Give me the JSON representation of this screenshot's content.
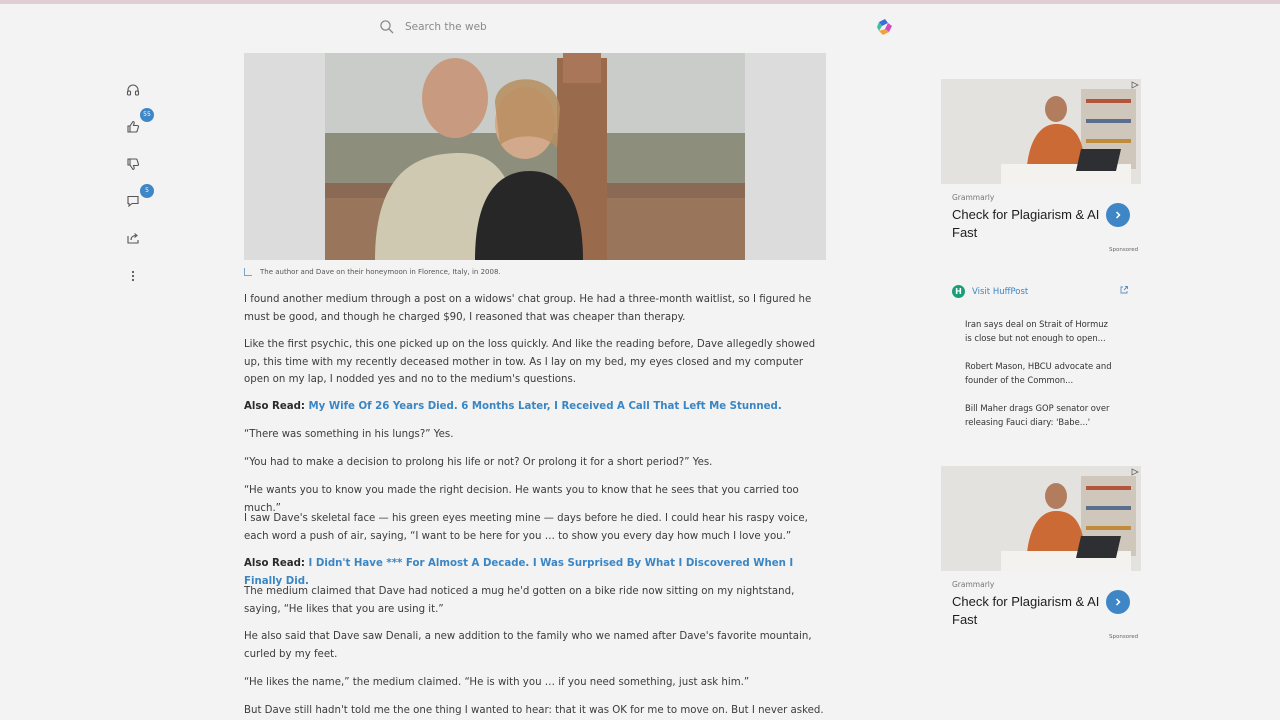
{
  "search": {
    "placeholder": "Search the web"
  },
  "rail": {
    "likes_count": "55",
    "comments_count": "5"
  },
  "hero": {
    "caption": "The author and Dave on their honeymoon in Florence, Italy, in 2008."
  },
  "article": {
    "p1": "I found another medium through a post on a widows' chat group. He had a three-month waitlist, so I figured he must be good, and though he charged $90, I reasoned that was cheaper than therapy.",
    "p2": "Like the first psychic, this one picked up on the loss quickly. And like the reading before, Dave allegedly showed up, this time with my recently deceased mother in tow. As I lay on my bed, my eyes closed and my computer open on my lap, I nodded yes and no to the medium's questions.",
    "also_read_label": "Also Read:",
    "also_read_1": "My Wife Of 26 Years Died. 6 Months Later, I Received A Call That Left Me Stunned.",
    "p3": "“There was something in his lungs?” Yes.",
    "p4": "“You had to make a decision to prolong his life or not? Or prolong it for a short period?” Yes.",
    "p5": "“He wants you to know you made the right decision. He wants you to know that he sees that you carried too much.”",
    "p6": "I saw Dave's skeletal face — his green eyes meeting mine — days before he died. I could hear his raspy voice, each word a push of air, saying, “I want to be here for you … to show you every day how much I love you.”",
    "also_read_2": "I Didn't Have *** For Almost A Decade. I Was Surprised By What I Discovered When I Finally Did.",
    "p7": "The medium claimed that Dave had noticed a mug he'd gotten on a bike ride now sitting on my nightstand, saying, “He likes that you are using it.”",
    "p8": "He also said that Dave saw Denali, a new addition to the family who we named after Dave's favorite mountain, curled by my feet.",
    "p9": "“He likes the name,” the medium claimed. “He is with you … if you need something, just ask him.”",
    "p10": "But Dave still hadn't told me the one thing I wanted to hear: that it was OK for me to move on. But I never asked."
  },
  "ads": [
    {
      "brand": "Grammarly",
      "title": "Check for Plagiarism & AI Fast",
      "sponsored": "Sponsored"
    },
    {
      "brand": "Grammarly",
      "title": "Check for Plagiarism & AI Fast",
      "sponsored": "Sponsored"
    }
  ],
  "huffpost": {
    "link": "Visit HuffPost",
    "items": [
      "Iran says deal on Strait of Hormuz is close but not enough to open...",
      "Robert Mason, HBCU advocate and founder of the Common...",
      "Bill Maher drags GOP senator over releasing Fauci diary: 'Babe...'"
    ]
  },
  "colors": {
    "accent": "#3a86c4",
    "badge": "#3f86c6",
    "background": "#f3f3f3"
  }
}
